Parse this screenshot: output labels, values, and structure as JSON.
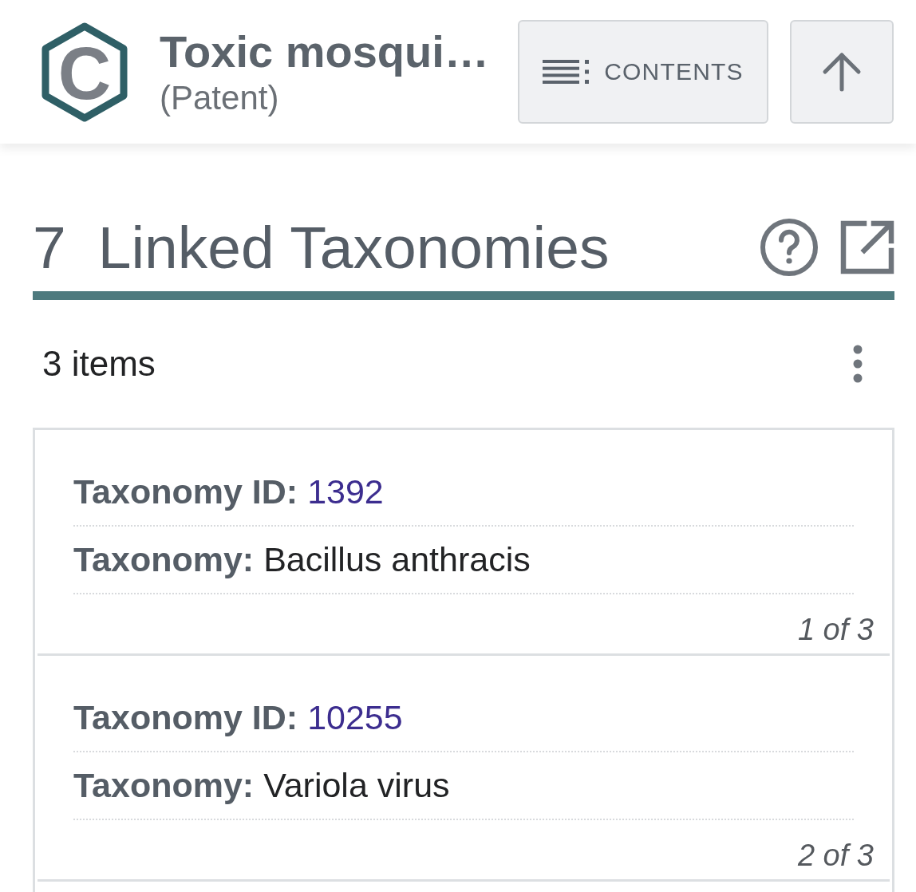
{
  "header": {
    "logo": {
      "letter": "C"
    },
    "title": "Toxic mosqui…",
    "subtitle": "(Patent)",
    "contents_button": "CONTENTS"
  },
  "section": {
    "number": "7",
    "title": "Linked Taxonomies"
  },
  "list": {
    "count": "3 items",
    "items": [
      {
        "fields": [
          {
            "label": "Taxonomy ID:",
            "value": "1392",
            "kind": "link"
          },
          {
            "label": "Taxonomy:",
            "value": "Bacillus anthracis",
            "kind": "text"
          }
        ],
        "position": "1 of 3"
      },
      {
        "fields": [
          {
            "label": "Taxonomy ID:",
            "value": "10255",
            "kind": "link"
          },
          {
            "label": "Taxonomy:",
            "value": "Variola virus",
            "kind": "text"
          }
        ],
        "position": "2 of 3"
      }
    ]
  }
}
